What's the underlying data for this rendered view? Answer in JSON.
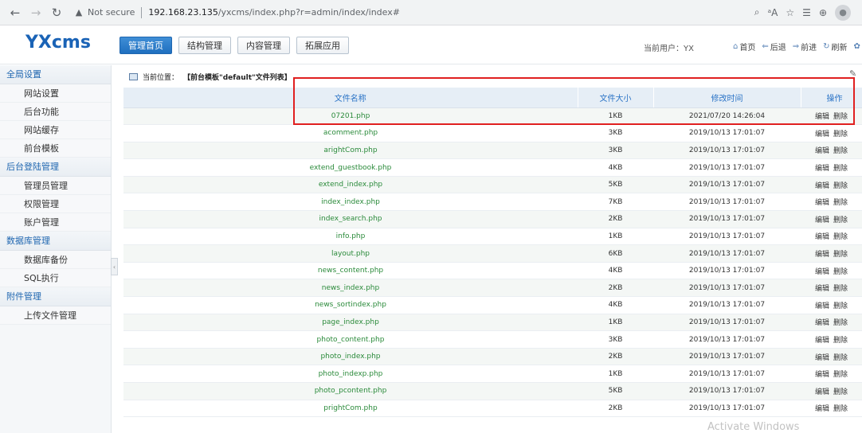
{
  "browser": {
    "security_label": "Not secure",
    "host": "192.168.23.135",
    "path": "/yxcms/index.php?r=admin/index/index#"
  },
  "header": {
    "logo": "YXcms",
    "tabs": [
      {
        "label": "管理首页",
        "active": true
      },
      {
        "label": "结构管理",
        "active": false
      },
      {
        "label": "内容管理",
        "active": false
      },
      {
        "label": "拓展应用",
        "active": false
      }
    ],
    "current_user": "当前用户：YX",
    "links": {
      "home": "首页",
      "back": "后退",
      "forward": "前进",
      "refresh": "刷新"
    }
  },
  "sidebar": {
    "groups": [
      {
        "title": "全局设置",
        "items": [
          "网站设置",
          "后台功能",
          "网站缓存",
          "前台模板"
        ]
      },
      {
        "title": "后台登陆管理",
        "items": [
          "管理员管理",
          "权限管理",
          "账户管理"
        ]
      },
      {
        "title": "数据库管理",
        "items": [
          "数据库备份",
          "SQL执行"
        ]
      },
      {
        "title": "附件管理",
        "items": [
          "上传文件管理"
        ]
      }
    ]
  },
  "breadcrumb": {
    "label": "当前位置：",
    "value": "【前台模板\"default\"文件列表】"
  },
  "table": {
    "headers": [
      "文件名称",
      "文件大小",
      "修改时间",
      "操作"
    ],
    "edit_label": "编辑",
    "delete_label": "删除",
    "rows": [
      {
        "name": "07201.php",
        "size": "1KB",
        "time": "2021/07/20 14:26:04"
      },
      {
        "name": "acomment.php",
        "size": "3KB",
        "time": "2019/10/13 17:01:07"
      },
      {
        "name": "arightCom.php",
        "size": "3KB",
        "time": "2019/10/13 17:01:07"
      },
      {
        "name": "extend_guestbook.php",
        "size": "4KB",
        "time": "2019/10/13 17:01:07"
      },
      {
        "name": "extend_index.php",
        "size": "5KB",
        "time": "2019/10/13 17:01:07"
      },
      {
        "name": "index_index.php",
        "size": "7KB",
        "time": "2019/10/13 17:01:07"
      },
      {
        "name": "index_search.php",
        "size": "2KB",
        "time": "2019/10/13 17:01:07"
      },
      {
        "name": "info.php",
        "size": "1KB",
        "time": "2019/10/13 17:01:07"
      },
      {
        "name": "layout.php",
        "size": "6KB",
        "time": "2019/10/13 17:01:07"
      },
      {
        "name": "news_content.php",
        "size": "4KB",
        "time": "2019/10/13 17:01:07"
      },
      {
        "name": "news_index.php",
        "size": "2KB",
        "time": "2019/10/13 17:01:07"
      },
      {
        "name": "news_sortindex.php",
        "size": "4KB",
        "time": "2019/10/13 17:01:07"
      },
      {
        "name": "page_index.php",
        "size": "1KB",
        "time": "2019/10/13 17:01:07"
      },
      {
        "name": "photo_content.php",
        "size": "3KB",
        "time": "2019/10/13 17:01:07"
      },
      {
        "name": "photo_index.php",
        "size": "2KB",
        "time": "2019/10/13 17:01:07"
      },
      {
        "name": "photo_indexp.php",
        "size": "1KB",
        "time": "2019/10/13 17:01:07"
      },
      {
        "name": "photo_pcontent.php",
        "size": "5KB",
        "time": "2019/10/13 17:01:07"
      },
      {
        "name": "prightCom.php",
        "size": "2KB",
        "time": "2019/10/13 17:01:07"
      }
    ]
  },
  "watermark": "Activate Windows"
}
